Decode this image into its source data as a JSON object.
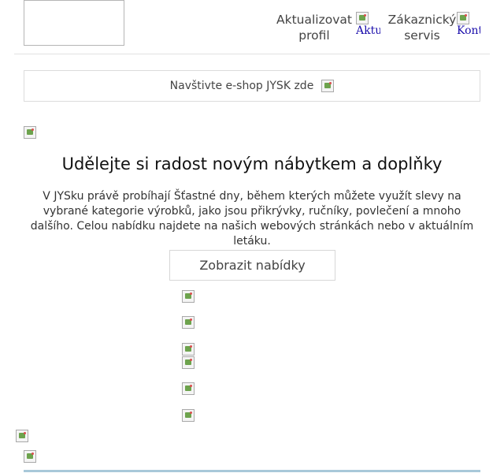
{
  "header": {
    "update_profile_label": "Aktualizovat profil",
    "update_profile_alt": "Aktu",
    "customer_service_label": "Zákaznický servis",
    "customer_service_alt": "Kont"
  },
  "eshop_banner": {
    "text": "Navštivte e-shop JYSK zde"
  },
  "main": {
    "headline": "Udělejte si radost novým nábytkem a doplňky",
    "body": "V JYSku právě probíhají Šťastné dny, během kterých můžete využít slevy na vybrané kategorie výrobků, jako jsou přikrývky, ručníky, povlečení a mnoho dalšího. Celou nabídku najdete na našich webových stránkách nebo v aktuálním letáku.",
    "cta_label": "Zobrazit nabídky"
  },
  "icons": {
    "broken_image": "broken-image-icon"
  }
}
